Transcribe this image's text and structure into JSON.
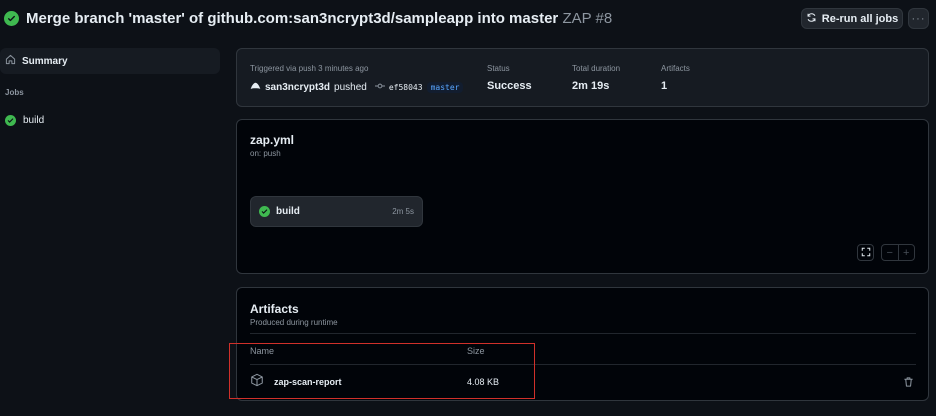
{
  "header": {
    "title": "Merge branch 'master' of github.com:san3ncrypt3d/sampleapp into master",
    "run_id": "ZAP #8",
    "rerun_label": "Re-run all jobs",
    "more_label": "···",
    "status_icon": "check-circle-fill"
  },
  "sidebar": {
    "summary_label": "Summary",
    "jobs_label": "Jobs",
    "jobs": [
      {
        "label": "build",
        "status": "success"
      }
    ]
  },
  "summary": {
    "triggered_label": "Triggered via push 3 minutes ago",
    "actor": "san3ncrypt3d",
    "action": "pushed",
    "commit": "ef58043",
    "branch": "master",
    "status_label": "Status",
    "status_value": "Success",
    "duration_label": "Total duration",
    "duration_value": "2m 19s",
    "artifacts_label": "Artifacts",
    "artifacts_value": "1"
  },
  "workflow": {
    "file": "zap.yml",
    "trigger": "on: push",
    "job_name": "build",
    "job_duration": "2m 5s",
    "zoom_out": "−",
    "zoom_in": "+"
  },
  "artifacts": {
    "title": "Artifacts",
    "subtitle": "Produced during runtime",
    "col_name": "Name",
    "col_size": "Size",
    "items": [
      {
        "name": "zap-scan-report",
        "size": "4.08 KB"
      }
    ]
  },
  "colors": {
    "success": "#3fb950",
    "highlight": "#d0302a",
    "background": "#0d1117"
  }
}
